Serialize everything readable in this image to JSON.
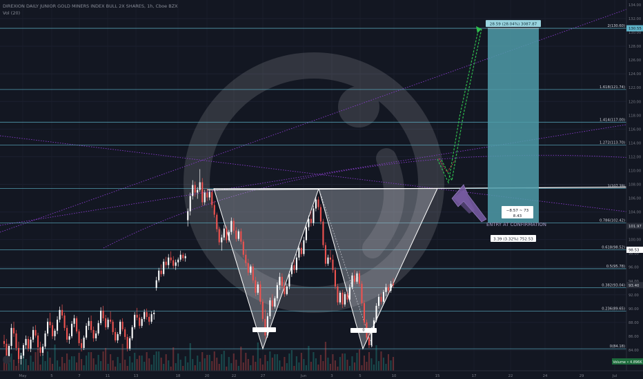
{
  "header": {
    "title": "DIREXION DAILY JUNIOR GOLD MINERS INDEX BULL 2X SHARES, 1h, Cboe BZX",
    "indicator": "Vol (20)"
  },
  "colors": {
    "background": "#131722",
    "up": "#26a69a",
    "down": "#ef5350",
    "up_candle": "#ffffff",
    "fib_line": "#5fb4c9",
    "pattern_fill": "#b8bcc6",
    "target_box": "#4f9ba8",
    "trend_purple": "#8a3ccf",
    "projection_green": "#2fbf4e",
    "arrow_purple": "#7b5ea7"
  },
  "chart_data": {
    "type": "candlestick",
    "symbol": "DIREXION DAILY JUNIOR GOLD MINERS INDEX BULL 2X SHARES",
    "interval": "1h",
    "exchange": "Cboe BZX",
    "ylim": [
      81,
      134.5
    ],
    "x_ticks": [
      "May",
      "5",
      "7",
      "11",
      "13",
      "18",
      "20",
      "22",
      "27",
      "Jun",
      "3",
      "5",
      "10",
      "15",
      "17",
      "22",
      "24",
      "29",
      "Jul"
    ],
    "y_ticks": [
      "84.00",
      "86.00",
      "88.00",
      "90.00",
      "92.00",
      "94.00",
      "96.00",
      "98.00",
      "100.00",
      "102.00",
      "104.00",
      "106.00",
      "108.00",
      "110.00",
      "112.00",
      "114.00",
      "116.00",
      "118.00",
      "120.00",
      "122.00",
      "124.00",
      "126.00",
      "128.00",
      "130.00",
      "132.00",
      "134.00"
    ],
    "fib_levels": [
      {
        "label": "2(130.60)",
        "price": 130.6
      },
      {
        "label": "1.618(121.74)",
        "price": 121.74
      },
      {
        "label": "1.414(117.00)",
        "price": 117.0
      },
      {
        "label": "1.272(113.70)",
        "price": 113.7
      },
      {
        "label": "1(107.39)",
        "price": 107.39
      },
      {
        "label": "0.786(102.42)",
        "price": 102.42
      },
      {
        "label": "0.618(98.52)",
        "price": 98.52
      },
      {
        "label": "0.5(95.78)",
        "price": 95.78
      },
      {
        "label": "0.382(93.04)",
        "price": 93.04
      },
      {
        "label": "0.236(89.65)",
        "price": 89.65
      },
      {
        "label": "0(84.18)",
        "price": 84.18
      }
    ],
    "price_badges": [
      {
        "label": "130.55",
        "price": 130.6,
        "color": "#5fb4c9"
      },
      {
        "label": "101.97",
        "price": 101.97,
        "color": "#2a2e39"
      },
      {
        "label": "98.53",
        "price": 98.52,
        "color": "#ffffff"
      },
      {
        "label": "93.40",
        "price": 93.4,
        "color": "#2a2e39"
      }
    ],
    "volume_badge": "Volume  • 4.896K",
    "annotations": {
      "target_label": "28.59 (28.04%) 3087.87",
      "box_measure_top": "−8.57 ~ 73",
      "box_measure_bottom": "8.43",
      "entry_text": "ENTRY AT CONFIRMATION",
      "stop_label": "3.39 (3.32%) 752.53",
      "trough1_label": "",
      "trough2_label": "0"
    },
    "candles": [
      [
        85.3,
        86.2,
        84.4,
        84.9
      ],
      [
        84.9,
        85.6,
        82.5,
        83.1
      ],
      [
        83.1,
        84.9,
        82.8,
        84.6
      ],
      [
        84.6,
        87.8,
        84.1,
        87.2
      ],
      [
        87.2,
        88.1,
        85.9,
        86.4
      ],
      [
        86.4,
        86.9,
        83.9,
        84.3
      ],
      [
        84.3,
        85.2,
        82.1,
        82.7
      ],
      [
        82.7,
        83.6,
        81.9,
        83.2
      ],
      [
        83.2,
        85.0,
        82.8,
        84.7
      ],
      [
        84.7,
        86.1,
        84.2,
        85.6
      ],
      [
        85.6,
        86.0,
        83.8,
        84.2
      ],
      [
        84.2,
        85.9,
        83.7,
        85.5
      ],
      [
        85.5,
        87.4,
        85.1,
        86.9
      ],
      [
        86.9,
        87.6,
        85.8,
        86.1
      ],
      [
        86.1,
        86.5,
        84.0,
        84.4
      ],
      [
        84.4,
        85.2,
        83.1,
        83.6
      ],
      [
        83.6,
        84.9,
        83.2,
        84.5
      ],
      [
        84.5,
        86.8,
        84.2,
        86.4
      ],
      [
        86.4,
        88.6,
        86.0,
        88.1
      ],
      [
        88.1,
        89.4,
        87.2,
        87.6
      ],
      [
        87.6,
        88.0,
        85.6,
        86.0
      ],
      [
        86.0,
        87.1,
        85.4,
        86.8
      ],
      [
        86.8,
        88.9,
        86.3,
        88.4
      ],
      [
        88.4,
        90.3,
        88.0,
        89.8
      ],
      [
        89.8,
        90.6,
        88.6,
        89.0
      ],
      [
        89.0,
        89.4,
        86.8,
        87.2
      ],
      [
        87.2,
        87.6,
        85.1,
        85.5
      ],
      [
        85.5,
        86.4,
        84.9,
        86.0
      ],
      [
        86.0,
        88.2,
        85.7,
        87.8
      ],
      [
        87.8,
        89.1,
        87.3,
        88.6
      ],
      [
        88.6,
        88.9,
        86.4,
        86.7
      ],
      [
        86.7,
        87.0,
        84.6,
        85.0
      ],
      [
        85.0,
        85.6,
        83.8,
        84.3
      ],
      [
        84.3,
        86.1,
        84.0,
        85.8
      ],
      [
        85.8,
        87.9,
        85.5,
        87.5
      ],
      [
        87.5,
        88.7,
        86.9,
        88.2
      ],
      [
        88.2,
        89.0,
        86.5,
        86.9
      ],
      [
        86.9,
        87.4,
        85.2,
        85.7
      ],
      [
        85.7,
        86.8,
        85.3,
        86.4
      ],
      [
        86.4,
        88.3,
        86.1,
        87.9
      ],
      [
        87.9,
        90.2,
        87.6,
        89.7
      ],
      [
        89.7,
        90.4,
        88.2,
        88.6
      ],
      [
        88.6,
        89.1,
        86.9,
        87.3
      ],
      [
        87.3,
        88.7,
        87.0,
        88.4
      ],
      [
        88.4,
        89.6,
        87.8,
        88.1
      ],
      [
        88.1,
        88.4,
        86.2,
        86.6
      ],
      [
        86.6,
        87.2,
        85.1,
        85.4
      ],
      [
        85.4,
        86.6,
        85.0,
        86.3
      ],
      [
        86.3,
        88.4,
        86.0,
        88.1
      ],
      [
        88.1,
        88.6,
        86.7,
        87.0
      ],
      [
        87.0,
        87.3,
        85.5,
        85.9
      ],
      [
        85.9,
        86.3,
        83.8,
        84.2
      ],
      [
        84.2,
        86.0,
        83.9,
        85.7
      ],
      [
        85.7,
        87.6,
        85.4,
        87.3
      ],
      [
        87.3,
        89.5,
        87.0,
        89.1
      ],
      [
        89.1,
        90.1,
        88.3,
        88.7
      ],
      [
        88.7,
        89.2,
        87.1,
        87.5
      ],
      [
        87.5,
        88.8,
        87.2,
        88.5
      ],
      [
        88.5,
        89.9,
        88.1,
        89.5
      ],
      [
        89.5,
        90.0,
        88.4,
        88.8
      ],
      [
        88.8,
        89.3,
        87.6,
        88.1
      ],
      [
        88.1,
        89.6,
        87.8,
        89.2
      ],
      [
        89.2,
        89.8,
        88.4,
        89.4
      ],
      [
        93.0,
        94.6,
        92.6,
        94.1
      ],
      [
        94.1,
        95.9,
        93.8,
        95.5
      ],
      [
        95.5,
        96.4,
        94.6,
        95.0
      ],
      [
        95.0,
        97.2,
        94.7,
        96.8
      ],
      [
        96.8,
        97.5,
        95.9,
        96.3
      ],
      [
        96.3,
        97.9,
        95.8,
        97.4
      ],
      [
        97.4,
        98.3,
        96.6,
        97.0
      ],
      [
        97.0,
        97.6,
        95.8,
        96.2
      ],
      [
        96.2,
        97.1,
        95.6,
        96.7
      ],
      [
        96.7,
        97.4,
        96.1,
        97.1
      ],
      [
        97.1,
        98.4,
        96.8,
        97.8
      ],
      [
        97.8,
        98.1,
        96.9,
        97.3
      ],
      [
        97.3,
        98.0,
        96.8,
        97.6
      ],
      [
        102.8,
        104.5,
        101.9,
        104.1
      ],
      [
        104.1,
        106.8,
        103.5,
        106.3
      ],
      [
        106.3,
        108.6,
        105.8,
        107.9
      ],
      [
        107.9,
        108.4,
        106.2,
        106.8
      ],
      [
        106.8,
        107.6,
        105.9,
        107.2
      ],
      [
        107.2,
        110.2,
        106.9,
        108.3
      ],
      [
        108.3,
        108.9,
        104.9,
        105.4
      ],
      [
        105.4,
        107.2,
        105.0,
        106.8
      ],
      [
        106.8,
        107.4,
        105.6,
        106.1
      ],
      [
        106.1,
        107.3,
        105.7,
        106.9
      ],
      [
        106.9,
        107.1,
        104.6,
        105.0
      ],
      [
        105.0,
        105.6,
        103.2,
        103.6
      ],
      [
        103.6,
        103.9,
        101.1,
        101.5
      ],
      [
        101.5,
        101.8,
        99.2,
        99.6
      ],
      [
        99.6,
        100.7,
        98.4,
        100.3
      ],
      [
        100.3,
        102.1,
        99.9,
        101.6
      ],
      [
        101.6,
        102.0,
        99.5,
        99.9
      ],
      [
        99.9,
        101.4,
        99.6,
        101.1
      ],
      [
        101.1,
        103.2,
        100.7,
        102.7
      ],
      [
        102.7,
        103.1,
        100.9,
        101.3
      ],
      [
        101.3,
        101.8,
        99.7,
        100.1
      ],
      [
        100.1,
        101.5,
        99.8,
        101.2
      ],
      [
        101.2,
        101.6,
        99.3,
        99.7
      ],
      [
        99.7,
        100.0,
        97.4,
        97.8
      ],
      [
        97.8,
        98.5,
        96.1,
        96.6
      ],
      [
        96.6,
        97.2,
        94.8,
        95.2
      ],
      [
        95.2,
        96.4,
        94.9,
        96.1
      ],
      [
        96.1,
        96.5,
        93.7,
        94.1
      ],
      [
        94.1,
        94.6,
        91.8,
        92.3
      ],
      [
        92.3,
        93.9,
        92.0,
        93.5
      ],
      [
        93.5,
        94.0,
        90.6,
        91.0
      ],
      [
        91.0,
        91.4,
        88.1,
        88.5
      ],
      [
        88.5,
        89.9,
        85.6,
        86.1
      ],
      [
        86.1,
        89.4,
        85.8,
        88.9
      ],
      [
        88.9,
        91.6,
        88.5,
        91.2
      ],
      [
        91.2,
        92.1,
        89.8,
        90.3
      ],
      [
        90.3,
        91.8,
        90.0,
        91.5
      ],
      [
        91.5,
        93.8,
        91.1,
        93.4
      ],
      [
        93.4,
        95.2,
        92.7,
        94.6
      ],
      [
        94.6,
        95.1,
        92.9,
        93.3
      ],
      [
        93.3,
        94.1,
        91.7,
        92.1
      ],
      [
        92.1,
        93.6,
        91.9,
        93.2
      ],
      [
        93.2,
        95.4,
        92.8,
        95.0
      ],
      [
        95.0,
        96.7,
        94.6,
        96.3
      ],
      [
        96.3,
        97.1,
        95.1,
        95.6
      ],
      [
        95.6,
        97.9,
        95.2,
        97.4
      ],
      [
        97.4,
        99.3,
        97.0,
        98.8
      ],
      [
        98.8,
        99.6,
        97.5,
        97.9
      ],
      [
        97.9,
        100.4,
        97.6,
        99.9
      ],
      [
        99.9,
        102.3,
        99.5,
        101.8
      ],
      [
        101.8,
        103.5,
        101.3,
        103.0
      ],
      [
        103.0,
        104.2,
        101.9,
        102.4
      ],
      [
        102.4,
        104.9,
        102.0,
        104.5
      ],
      [
        104.5,
        106.3,
        104.1,
        105.8
      ],
      [
        105.8,
        106.2,
        104.3,
        104.7
      ],
      [
        104.7,
        105.1,
        102.2,
        102.6
      ],
      [
        102.6,
        103.0,
        98.8,
        99.2
      ],
      [
        99.2,
        99.6,
        96.1,
        96.5
      ],
      [
        96.5,
        97.8,
        96.2,
        97.4
      ],
      [
        97.4,
        98.5,
        96.7,
        97.1
      ],
      [
        97.1,
        97.8,
        95.2,
        95.6
      ],
      [
        95.6,
        96.0,
        92.8,
        93.2
      ],
      [
        93.2,
        93.6,
        90.5,
        90.9
      ],
      [
        90.9,
        92.6,
        90.6,
        92.3
      ],
      [
        92.3,
        92.7,
        90.1,
        90.6
      ],
      [
        90.6,
        92.4,
        90.3,
        92.1
      ],
      [
        92.1,
        92.5,
        90.9,
        91.3
      ],
      [
        91.3,
        93.5,
        91.0,
        93.1
      ],
      [
        93.1,
        95.2,
        92.8,
        94.8
      ],
      [
        94.8,
        95.6,
        93.5,
        93.9
      ],
      [
        93.9,
        95.4,
        93.6,
        95.1
      ],
      [
        95.1,
        95.5,
        93.2,
        93.6
      ],
      [
        93.6,
        94.0,
        90.4,
        90.8
      ],
      [
        90.8,
        91.2,
        87.6,
        88.0
      ],
      [
        88.0,
        88.4,
        85.4,
        85.8
      ],
      [
        85.8,
        86.5,
        84.3,
        84.7
      ],
      [
        84.7,
        87.3,
        84.4,
        86.9
      ],
      [
        86.9,
        88.7,
        86.6,
        88.3
      ],
      [
        88.3,
        90.8,
        88.0,
        90.4
      ],
      [
        90.4,
        92.1,
        90.0,
        91.7
      ],
      [
        91.7,
        92.2,
        90.6,
        91.0
      ],
      [
        91.0,
        92.7,
        90.7,
        92.4
      ],
      [
        92.4,
        93.6,
        91.8,
        93.1
      ],
      [
        93.1,
        93.5,
        92.2,
        92.6
      ],
      [
        92.6,
        94.0,
        92.3,
        93.6
      ],
      [
        93.6,
        94.4,
        93.0,
        93.4
      ]
    ]
  }
}
